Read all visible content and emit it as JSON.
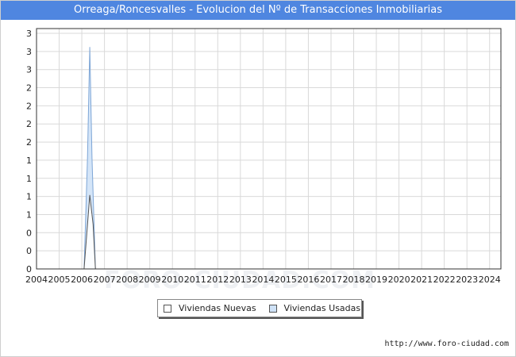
{
  "header": {
    "title": "Orreaga/Roncesvalles - Evolucion del Nº de Transacciones Inmobiliarias"
  },
  "footer": {
    "source": "http://www.foro-ciudad.com"
  },
  "watermark": "FORO-CIUDAD.COM",
  "colors": {
    "title_bg": "#4f86e0",
    "nuevas_fill": "#ffffff",
    "usadas_fill": "#cfe2f7",
    "usadas_stroke": "#7ea6d6",
    "grid": "#d9d9d9"
  },
  "chart_data": {
    "type": "area",
    "title": "Orreaga/Roncesvalles - Evolucion del Nº de Transacciones Inmobiliarias",
    "xlabel": "",
    "ylabel": "",
    "x_ticks": [
      "2004",
      "2005",
      "2006",
      "2007",
      "2008",
      "2009",
      "2010",
      "2011",
      "2012",
      "2013",
      "2014",
      "2015",
      "2016",
      "2017",
      "2018",
      "2019",
      "2020",
      "2021",
      "2022",
      "2023",
      "2024"
    ],
    "y_tick_labels": [
      "0",
      "0",
      "0",
      "1",
      "1",
      "1",
      "1",
      "2",
      "2",
      "2",
      "2",
      "3",
      "3",
      "3"
    ],
    "xlim": [
      2004,
      2024.5
    ],
    "ylim": [
      0,
      3.25
    ],
    "grid": true,
    "legend_position": "bottom",
    "series": [
      {
        "name": "Viviendas Nuevas",
        "x": [
          2006.0,
          2006.1,
          2006.25,
          2006.35,
          2006.5,
          2006.6,
          2024.5
        ],
        "values": [
          0,
          0,
          0.6,
          1,
          0.6,
          0,
          0
        ]
      },
      {
        "name": "Viviendas Usadas",
        "x": [
          2006.0,
          2006.1,
          2006.25,
          2006.35,
          2006.45,
          2006.6,
          2024.5
        ],
        "values": [
          0,
          0,
          1.5,
          3,
          1.5,
          0,
          0
        ]
      }
    ]
  }
}
